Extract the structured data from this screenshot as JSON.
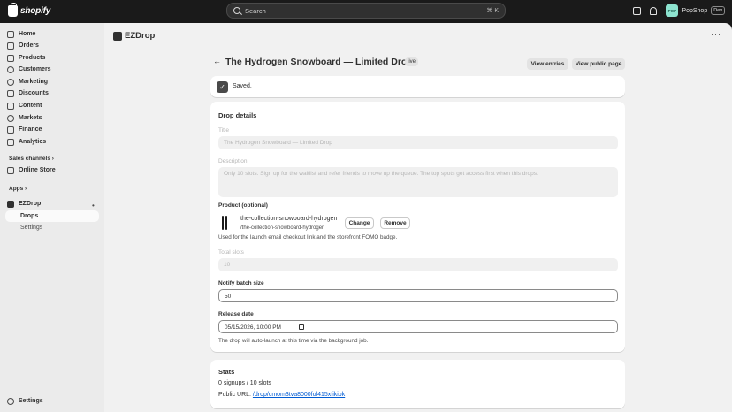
{
  "topbar": {
    "logo_text": "shopify",
    "search_placeholder": "Search",
    "shortcut": "⌘ K",
    "store_avatar": "POP",
    "store_name": "PopShop",
    "store_badge": "Dev"
  },
  "sidebar": {
    "items": [
      {
        "label": "Home",
        "icon": "home-icon"
      },
      {
        "label": "Orders",
        "icon": "orders-icon"
      },
      {
        "label": "Products",
        "icon": "tag-icon"
      },
      {
        "label": "Customers",
        "icon": "person-icon"
      },
      {
        "label": "Marketing",
        "icon": "target-icon"
      },
      {
        "label": "Discounts",
        "icon": "discount-icon"
      },
      {
        "label": "Content",
        "icon": "content-icon"
      },
      {
        "label": "Markets",
        "icon": "globe-icon"
      },
      {
        "label": "Finance",
        "icon": "bank-icon"
      },
      {
        "label": "Analytics",
        "icon": "chart-icon"
      }
    ],
    "sales_channels_label": "Sales channels ›",
    "online_store": "Online Store",
    "apps_label": "Apps ›",
    "app_name": "EZDrop",
    "app_subitems": [
      "Drops",
      "Settings"
    ],
    "settings": "Settings"
  },
  "app_header": {
    "title": "EZDrop",
    "more": "···"
  },
  "page": {
    "back_arrow": "←",
    "title": "The Hydrogen Snowboard — Limited Drop",
    "status_badge": "live",
    "view_entries": "View entries",
    "view_public": "View public page"
  },
  "toast": {
    "check": "✓",
    "text": "Saved."
  },
  "drop_details": {
    "heading": "Drop details",
    "title_label": "Title",
    "title_value": "The Hydrogen Snowboard — Limited Drop",
    "description_label": "Description",
    "description_value": "Only 10 slots. Sign up for the waitlist and refer friends to move up the queue. The top spots get access first when this drops.",
    "product_label": "Product (optional)",
    "product_name": "the-collection-snowboard-hydrogen",
    "product_handle": "/the-collection-snowboard-hydrogen",
    "change_btn": "Change",
    "remove_btn": "Remove",
    "product_help": "Used for the launch email checkout link and the storefront FOMO badge.",
    "total_slots_label": "Total slots",
    "total_slots_value": "10",
    "notify_label": "Notify batch size",
    "notify_value": "50",
    "release_label": "Release date",
    "release_value": "05/15/2026, 10:00 PM",
    "release_help": "The drop will auto-launch at this time via the background job."
  },
  "stats": {
    "heading": "Stats",
    "signups": "0 signups / 10 slots",
    "public_url_label": "Public URL:",
    "public_url": "/drop/cmom3tva8000fol415xfikipk"
  }
}
